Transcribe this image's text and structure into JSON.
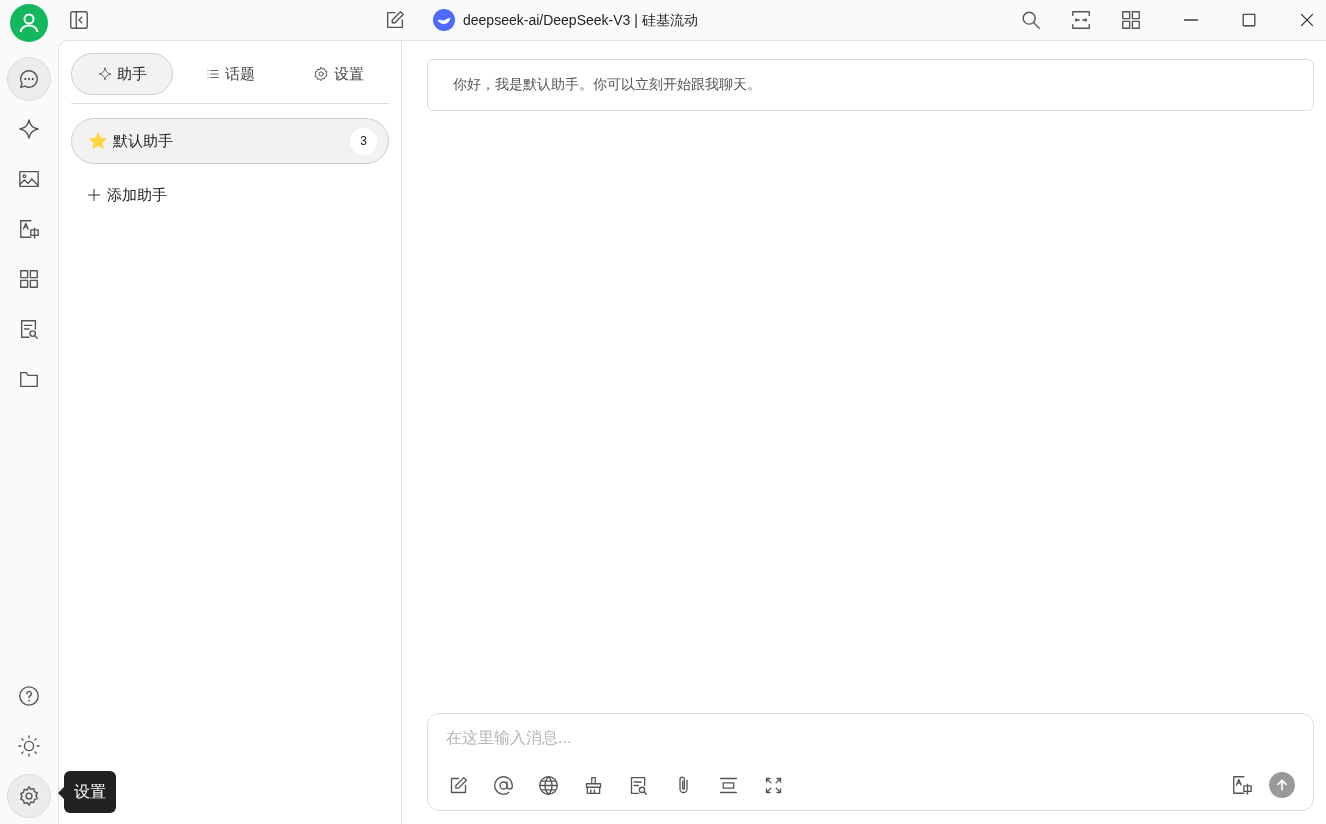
{
  "top_bar": {
    "model_title": "deepseek-ai/DeepSeek-V3 | 硅基流动"
  },
  "nav_rail": {
    "items": [
      {
        "selected": true
      },
      {
        "selected": false
      },
      {
        "selected": false
      },
      {
        "selected": false
      },
      {
        "selected": false
      },
      {
        "selected": false
      },
      {
        "selected": false
      }
    ],
    "bottom_items": [
      {
        "selected": false
      },
      {
        "selected": false
      },
      {
        "selected": true
      }
    ],
    "tooltip": "设置"
  },
  "sidebar": {
    "tabs": [
      {
        "label": "助手",
        "selected": true
      },
      {
        "label": "话题",
        "selected": false
      },
      {
        "label": "设置",
        "selected": false
      }
    ],
    "assistants": [
      {
        "name": "默认助手",
        "count": "3",
        "selected": true
      }
    ],
    "add_button": "添加助手"
  },
  "chat": {
    "messages": [
      "你好，我是默认助手。你可以立刻开始跟我聊天。"
    ],
    "input": {
      "placeholder": "在这里输入消息..."
    }
  }
}
